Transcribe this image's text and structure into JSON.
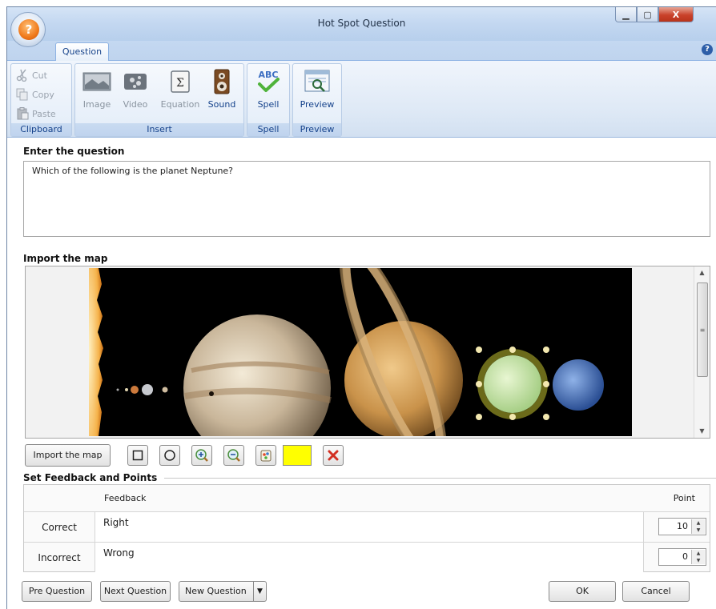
{
  "window": {
    "title": "Hot Spot Question",
    "app_icon": "app-orb-icon",
    "controls": [
      "minimize-icon",
      "maximize-icon",
      "close-icon"
    ],
    "close_glyph": "X"
  },
  "tabs": [
    {
      "label": "Question",
      "active": true
    }
  ],
  "ribbon": {
    "groups": [
      {
        "name": "Clipboard",
        "items": [
          {
            "label": "Cut",
            "icon": "scissors-icon",
            "enabled": false
          },
          {
            "label": "Copy",
            "icon": "copy-icon",
            "enabled": false
          },
          {
            "label": "Paste",
            "icon": "paste-icon",
            "enabled": false
          }
        ]
      },
      {
        "name": "Insert",
        "items": [
          {
            "label": "Image",
            "icon": "image-icon",
            "enabled": false
          },
          {
            "label": "Video",
            "icon": "video-icon",
            "enabled": false
          },
          {
            "label": "Equation",
            "icon": "equation-icon",
            "enabled": false
          },
          {
            "label": "Sound",
            "icon": "sound-icon",
            "enabled": true
          }
        ]
      },
      {
        "name": "Spell",
        "items": [
          {
            "label": "Spell",
            "icon": "spell-check-icon",
            "enabled": true
          }
        ]
      },
      {
        "name": "Preview",
        "items": [
          {
            "label": "Preview",
            "icon": "preview-icon",
            "enabled": true
          }
        ]
      }
    ]
  },
  "question_section": {
    "title": "Enter the question",
    "text": "Which of the following is the planet Neptune?"
  },
  "map_section": {
    "title": "Import the map",
    "image": "solar-system-planets-image",
    "import_button": "Import the map",
    "tools": [
      "rectangle-tool-icon",
      "circle-tool-icon",
      "zoom-in-icon",
      "zoom-out-icon",
      "paint-icon",
      "color-swatch",
      "delete-icon"
    ],
    "highlight_color": "#ffff00"
  },
  "feedback_section": {
    "title": "Set Feedback and Points",
    "headers": {
      "feedback": "Feedback",
      "point": "Point"
    },
    "rows": [
      {
        "label": "Correct",
        "feedback": "Right",
        "point": "10"
      },
      {
        "label": "Incorrect",
        "feedback": "Wrong",
        "point": "0"
      }
    ]
  },
  "footer": {
    "pre_question": "Pre Question",
    "next_question": "Next Question",
    "new_question": "New Question",
    "ok": "OK",
    "cancel": "Cancel"
  },
  "colors": {
    "ribbon_text": "#15428b",
    "titlebar": "#c4d8f1",
    "hotspot_outline": "#6b6a1a",
    "hotspot_handle": "#f3e8b0"
  }
}
